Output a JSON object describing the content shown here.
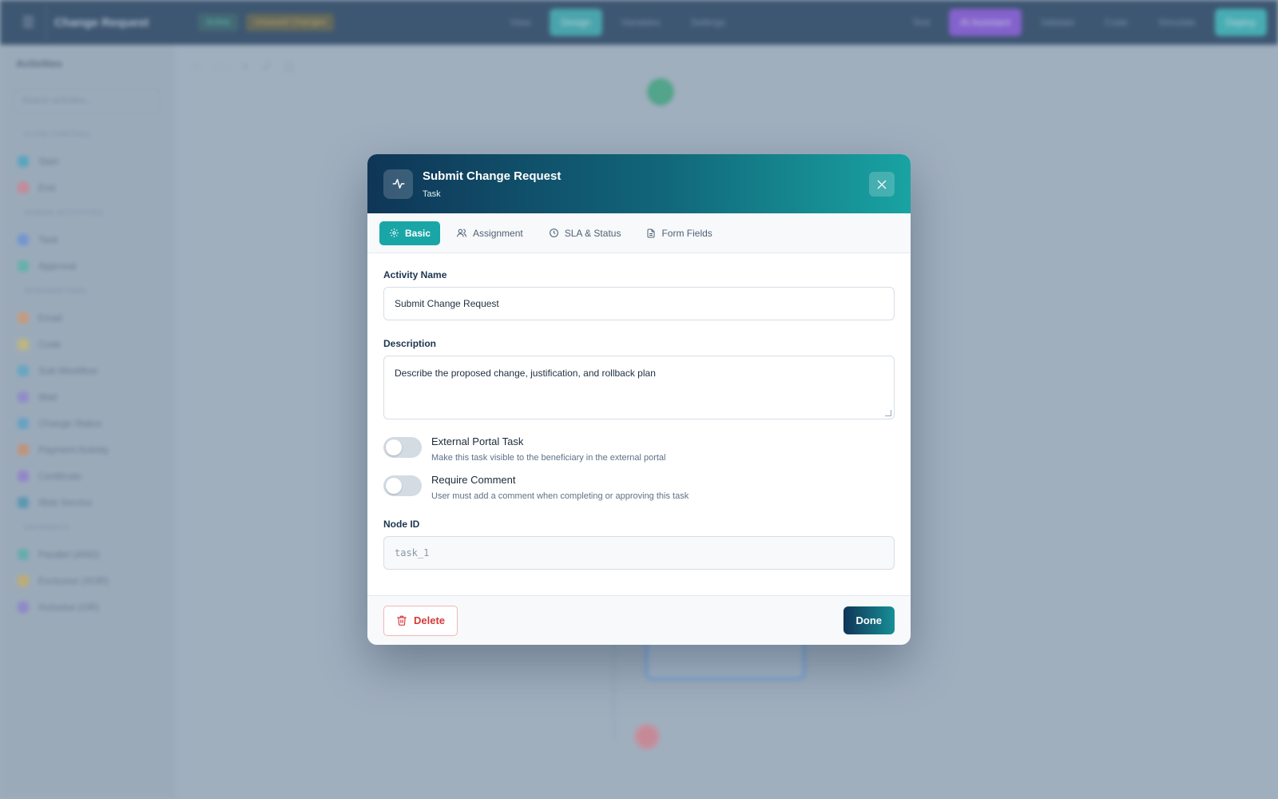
{
  "app": {
    "title": "Change Request",
    "status_badge": "Active",
    "unsaved_badge": "Unsaved Changes",
    "toolbar": [
      "View",
      "Design",
      "Variables",
      "Settings",
      "Test",
      "AI Assistant",
      "Validate",
      "Code",
      "Simulate",
      "Deploy"
    ]
  },
  "sidebar": {
    "title": "Activities",
    "search_placeholder": "Search activities...",
    "sections": [
      {
        "title": "FLOW CONTROL",
        "items": [
          {
            "label": "Start",
            "color": "#3aa4c0"
          },
          {
            "label": "End",
            "color": "#e07a86"
          }
        ]
      },
      {
        "title": "HUMAN ACTIVITIES",
        "items": [
          {
            "label": "Task",
            "color": "#5f8ee0"
          },
          {
            "label": "Approval",
            "color": "#4ab7a5"
          }
        ]
      },
      {
        "title": "INTEGRATIONS",
        "items": [
          {
            "label": "Email",
            "color": "#e0955f"
          },
          {
            "label": "Code",
            "color": "#d4c060"
          },
          {
            "label": "Sub-Workflow",
            "color": "#4fa6c9"
          },
          {
            "label": "Wait",
            "color": "#8f7ed4"
          },
          {
            "label": "Change Status",
            "color": "#4ea0c9"
          },
          {
            "label": "Payment Activity",
            "color": "#d68a5a"
          },
          {
            "label": "Certificate",
            "color": "#9076d1"
          },
          {
            "label": "Web Service",
            "color": "#3d8fb0"
          }
        ]
      },
      {
        "title": "GATEWAYS",
        "items": [
          {
            "label": "Parallel (AND)",
            "color": "#4db0a8"
          },
          {
            "label": "Exclusive (XOR)",
            "color": "#d4b050"
          },
          {
            "label": "Inclusive (OR)",
            "color": "#8a7ad0"
          }
        ]
      }
    ]
  },
  "modal": {
    "title": "Submit Change Request",
    "subtitle": "Task",
    "tabs": [
      {
        "label": "Basic",
        "icon": "gear-icon",
        "active": true
      },
      {
        "label": "Assignment",
        "icon": "users-icon",
        "active": false
      },
      {
        "label": "SLA & Status",
        "icon": "clock-icon",
        "active": false
      },
      {
        "label": "Form Fields",
        "icon": "document-icon",
        "active": false
      }
    ],
    "activity_name": {
      "label": "Activity Name",
      "value": "Submit Change Request"
    },
    "description": {
      "label": "Description",
      "value": "Describe the proposed change, justification, and rollback plan"
    },
    "toggles": [
      {
        "label": "External Portal Task",
        "description": "Make this task visible to the beneficiary in the external portal",
        "on": false
      },
      {
        "label": "Require Comment",
        "description": "User must add a comment when completing or approving this task",
        "on": false
      }
    ],
    "node_id": {
      "label": "Node ID",
      "value": "task_1"
    },
    "delete_label": "Delete",
    "done_label": "Done"
  },
  "colors": {
    "accent": "#1aa6a6",
    "header_start": "#0f3557",
    "danger": "#d23b3b"
  }
}
